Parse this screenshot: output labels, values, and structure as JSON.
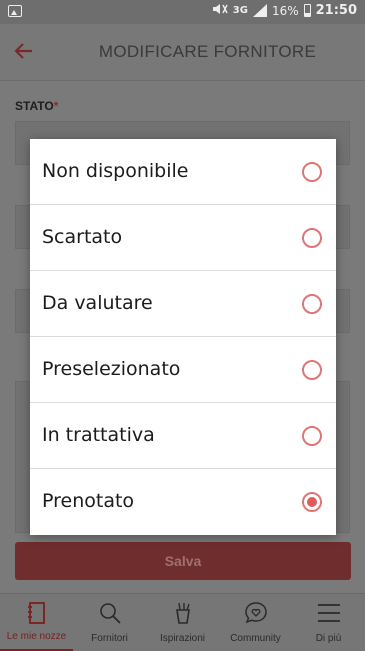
{
  "status_bar": {
    "network": "3G",
    "battery": "16%",
    "time": "21:50"
  },
  "app_bar": {
    "title": "MODIFICARE FORNITORE"
  },
  "form": {
    "stato_label": "STATO",
    "required_mark": "*",
    "save_label": "Salva"
  },
  "dialog": {
    "options": [
      {
        "label": "Non disponibile",
        "selected": false
      },
      {
        "label": "Scartato",
        "selected": false
      },
      {
        "label": "Da valutare",
        "selected": false
      },
      {
        "label": "Preselezionato",
        "selected": false
      },
      {
        "label": "In trattativa",
        "selected": false
      },
      {
        "label": "Prenotato",
        "selected": true
      }
    ]
  },
  "bottom_nav": {
    "items": [
      {
        "label": "Le mie nozze",
        "icon": "notebook-icon",
        "active": true
      },
      {
        "label": "Fornitori",
        "icon": "search-icon",
        "active": false
      },
      {
        "label": "Ispirazioni",
        "icon": "inspiration-icon",
        "active": false
      },
      {
        "label": "Community",
        "icon": "chat-heart-icon",
        "active": false
      },
      {
        "label": "Di più",
        "icon": "menu-icon",
        "active": false
      }
    ]
  },
  "colors": {
    "accent": "#e05a5a",
    "overlay": "#7a7a7a"
  }
}
